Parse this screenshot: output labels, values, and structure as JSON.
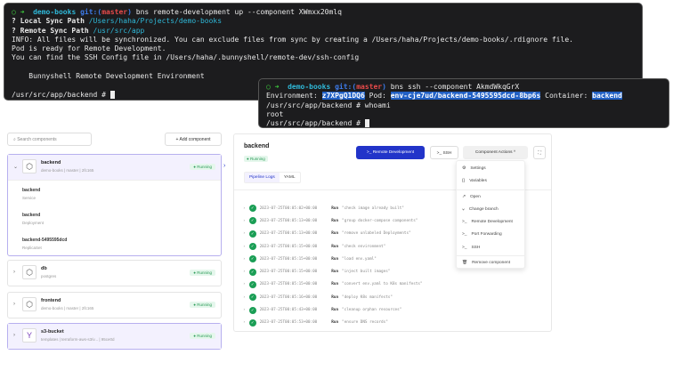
{
  "terminal1": {
    "prompt_dir": "demo-books",
    "git_label": "git:(",
    "branch": "master",
    "git_close": ")",
    "command": "bns remote-development up --component XWmxx20mlq",
    "q1_label": "? Local Sync Path",
    "q1_value": "/Users/haha/Projects/demo-books",
    "q2_label": "? Remote Sync Path",
    "q2_value": "/usr/src/app",
    "info": "INFO: All files will be synchronized. You can exclude files from sync by creating a /Users/haha/Projects/demo-books/.rdignore file.",
    "ready": "Pod is ready for Remote Development.",
    "ssh_config": "You can find the SSH Config file in /Users/haha/.bunnyshell/remote-dev/ssh-config",
    "banner": "Bunnyshell Remote Development Environment",
    "shell": "/usr/src/app/backend #"
  },
  "terminal2": {
    "prompt_dir": "demo-books",
    "git_label": "git:(",
    "branch": "master",
    "git_close": ")",
    "command": "bns ssh --component AkmdWkqGrX",
    "env_label": "Environment:",
    "env": "z7XPgQ1DQ6",
    "pod_label": "Pod:",
    "pod": "env-cje7ud/backend-5495595dcd-8bp6s",
    "container_label": "Container:",
    "container": "backend",
    "line_whoami": "/usr/src/app/backend # whoami",
    "root": "root",
    "shell": "/usr/src/app/backend #"
  },
  "left": {
    "search_placeholder": "Search components",
    "add_label": "+ Add component",
    "components": [
      {
        "name": "backend",
        "meta": "demo-books  |  master  |  2fc165",
        "status": "Running",
        "resources": [
          {
            "name": "backend",
            "type": "Service"
          },
          {
            "name": "backend",
            "type": "Deployment"
          },
          {
            "name": "backend-5495595dcd",
            "type": "ReplicaSet"
          }
        ]
      },
      {
        "name": "db",
        "meta": "postgres",
        "status": "Running"
      },
      {
        "name": "frontend",
        "meta": "demo-books  |  master  |  2fc165",
        "status": "Running"
      },
      {
        "name": "s3-bucket",
        "meta": "templates  |  terraform-aws-s3/v...  |  95ce0d",
        "status": "Running"
      }
    ]
  },
  "right": {
    "title": "backend",
    "status": "Running",
    "remote_dev": ">_ Remote Development",
    "ssh": ">_ SSH",
    "actions": "Component Actions ^",
    "tabs": [
      "Pipeline Logs",
      "YAML"
    ],
    "run_label": "Run",
    "logs": [
      {
        "ts": "2023-07-25T00:05:02+00:00",
        "msg": "\"check image already built\""
      },
      {
        "ts": "2023-07-25T00:05:13+00:00",
        "msg": "\"group docker-compose components\""
      },
      {
        "ts": "2023-07-25T00:05:13+00:00",
        "msg": "\"remove unlabeled Deployments\""
      },
      {
        "ts": "2023-07-25T00:05:15+00:00",
        "msg": "\"check environment\""
      },
      {
        "ts": "2023-07-25T00:05:15+00:00",
        "msg": "\"load env.yaml\""
      },
      {
        "ts": "2023-07-25T00:05:15+00:00",
        "msg": "\"inject built images\""
      },
      {
        "ts": "2023-07-25T00:05:15+00:00",
        "msg": "\"convert env.yaml to K8s manifests\""
      },
      {
        "ts": "2023-07-25T00:05:16+00:00",
        "msg": "\"deploy K8s manifests\""
      },
      {
        "ts": "2023-07-25T00:05:43+00:00",
        "msg": "\"cleanup orphan resources\""
      },
      {
        "ts": "2023-07-25T00:05:53+00:00",
        "msg": "\"ensure DNS records\""
      }
    ],
    "menu": [
      "Settings",
      "Variables",
      "Open",
      "Change branch",
      "Remote Development",
      "Port Forwarding",
      "SSH",
      "Remove component"
    ]
  },
  "colors": {
    "accent": "#2234c9",
    "running": "#2a9b57"
  }
}
